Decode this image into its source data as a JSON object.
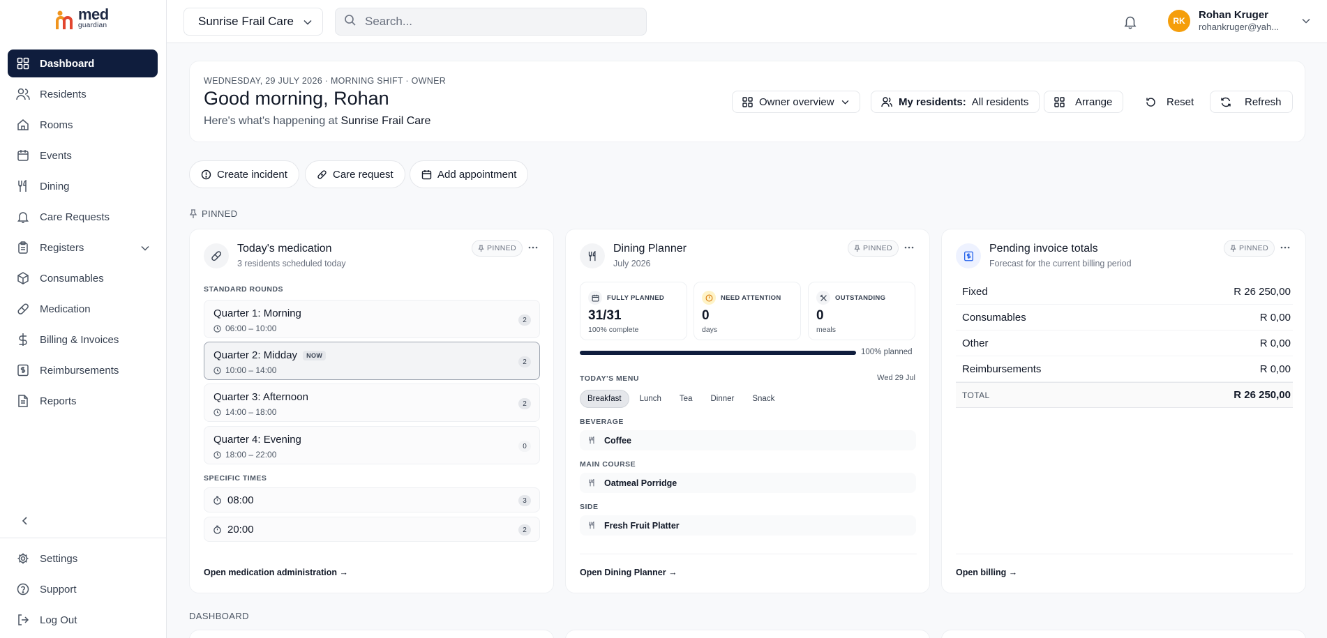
{
  "app": {
    "logo_mark": "m",
    "logo_word": "med",
    "logo_sub": "guardian"
  },
  "sidebar": {
    "items": [
      {
        "label": "Dashboard",
        "icon": "grid-icon"
      },
      {
        "label": "Residents",
        "icon": "users-icon"
      },
      {
        "label": "Rooms",
        "icon": "home-icon"
      },
      {
        "label": "Events",
        "icon": "calendar-icon"
      },
      {
        "label": "Dining",
        "icon": "utensils-icon"
      },
      {
        "label": "Care Requests",
        "icon": "bell-icon"
      },
      {
        "label": "Registers",
        "icon": "clipboard-icon"
      },
      {
        "label": "Consumables",
        "icon": "box-icon"
      },
      {
        "label": "Medication",
        "icon": "pill-icon"
      },
      {
        "label": "Billing & Invoices",
        "icon": "dollar-icon"
      },
      {
        "label": "Reimbursements",
        "icon": "receipt-icon"
      },
      {
        "label": "Reports",
        "icon": "document-icon"
      }
    ],
    "bottom": [
      {
        "label": "Settings",
        "icon": "gear-icon"
      },
      {
        "label": "Support",
        "icon": "help-icon"
      },
      {
        "label": "Log Out",
        "icon": "logout-icon"
      }
    ]
  },
  "header": {
    "facility": "Sunrise Frail Care",
    "search_placeholder": "Search...",
    "user_initials": "RK",
    "user_name": "Rohan Kruger",
    "user_email": "rohankruger@yah..."
  },
  "greeting": {
    "meta": "WEDNESDAY, 29 JULY 2026 · MORNING SHIFT · OWNER",
    "title": "Good morning, Rohan",
    "sub_prefix": "Here's what's happening at",
    "sub_facility": "Sunrise Frail Care",
    "buttons": {
      "overview": "Owner overview",
      "residents_label": "My residents:",
      "residents_value": "All residents",
      "arrange": "Arrange",
      "reset": "Reset",
      "refresh": "Refresh"
    }
  },
  "quick_actions": {
    "incident": "Create incident",
    "care": "Care request",
    "appointment": "Add appointment"
  },
  "sections": {
    "pinned": "PINNED",
    "dashboard": "DASHBOARD"
  },
  "pinned_label": "PINNED",
  "medication": {
    "title": "Today's medication",
    "sub": "3 residents scheduled today",
    "standard_label": "STANDARD ROUNDS",
    "now_label": "NOW",
    "rounds": [
      {
        "name": "Quarter 1: Morning",
        "time": "06:00 – 10:00",
        "count": "2"
      },
      {
        "name": "Quarter 2: Midday",
        "time": "10:00 – 14:00",
        "count": "2"
      },
      {
        "name": "Quarter 3: Afternoon",
        "time": "14:00 – 18:00",
        "count": "2"
      },
      {
        "name": "Quarter 4: Evening",
        "time": "18:00 – 22:00",
        "count": "0"
      }
    ],
    "specific_label": "SPECIFIC TIMES",
    "specific": [
      {
        "time": "08:00",
        "count": "3"
      },
      {
        "time": "20:00",
        "count": "2"
      }
    ],
    "link": "Open medication administration →"
  },
  "dining": {
    "title": "Dining Planner",
    "sub": "July 2026",
    "stats": [
      {
        "head": "FULLY PLANNED",
        "value": "31/31",
        "sub": "100% complete"
      },
      {
        "head": "NEED ATTENTION",
        "value": "0",
        "sub": "days"
      },
      {
        "head": "OUTSTANDING",
        "value": "0",
        "sub": "meals"
      }
    ],
    "progress": 1.0,
    "progress_label": "100% planned",
    "menu_label": "TODAY'S MENU",
    "menu_date": "Wed 29 Jul",
    "tabs": [
      "Breakfast",
      "Lunch",
      "Tea",
      "Dinner",
      "Snack"
    ],
    "courses": [
      {
        "label": "BEVERAGE",
        "dish": "Coffee"
      },
      {
        "label": "MAIN COURSE",
        "dish": "Oatmeal Porridge"
      },
      {
        "label": "SIDE",
        "dish": "Fresh Fruit Platter"
      }
    ],
    "link": "Open Dining Planner →"
  },
  "invoices": {
    "title": "Pending invoice totals",
    "sub": "Forecast for the current billing period",
    "rows": [
      {
        "label": "Fixed",
        "value": "R 26 250,00"
      },
      {
        "label": "Consumables",
        "value": "R 0,00"
      },
      {
        "label": "Other",
        "value": "R 0,00"
      },
      {
        "label": "Reimbursements",
        "value": "R 0,00"
      }
    ],
    "total_label": "TOTAL",
    "total_value": "R 26 250,00",
    "link": "Open billing →"
  },
  "colors": {
    "primary": "#0f1d3d",
    "accent": "#f59e0b",
    "logo_orange": "#f0941e",
    "logo_red": "#e2462f"
  }
}
